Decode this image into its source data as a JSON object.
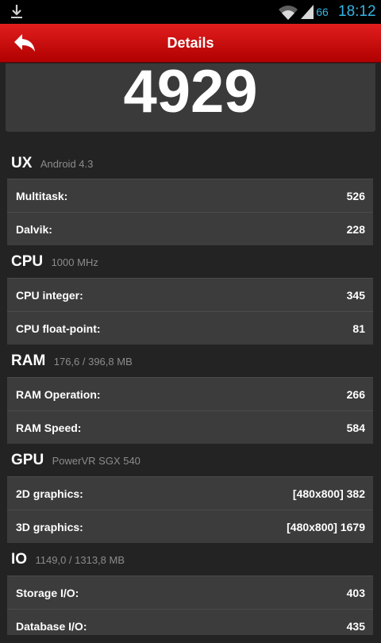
{
  "status_bar": {
    "battery": "66",
    "time": "18:12"
  },
  "header": {
    "title": "Details"
  },
  "score": "4929",
  "sections": [
    {
      "name": "UX",
      "info": "Android 4.3",
      "rows": [
        {
          "label": "Multitask:",
          "value": "526"
        },
        {
          "label": "Dalvik:",
          "value": "228"
        }
      ]
    },
    {
      "name": "CPU",
      "info": "1000 MHz",
      "rows": [
        {
          "label": "CPU integer:",
          "value": "345"
        },
        {
          "label": "CPU float-point:",
          "value": "81"
        }
      ]
    },
    {
      "name": "RAM",
      "info": "176,6 / 396,8 MB",
      "rows": [
        {
          "label": "RAM Operation:",
          "value": "266"
        },
        {
          "label": "RAM Speed:",
          "value": "584"
        }
      ]
    },
    {
      "name": "GPU",
      "info": "PowerVR SGX 540",
      "rows": [
        {
          "label": "2D graphics:",
          "value": "[480x800] 382"
        },
        {
          "label": "3D graphics:",
          "value": "[480x800] 1679"
        }
      ]
    },
    {
      "name": "IO",
      "info": "1149,0 / 1313,8 MB",
      "rows": [
        {
          "label": "Storage I/O:",
          "value": "403"
        },
        {
          "label": "Database I/O:",
          "value": "435"
        }
      ]
    }
  ]
}
